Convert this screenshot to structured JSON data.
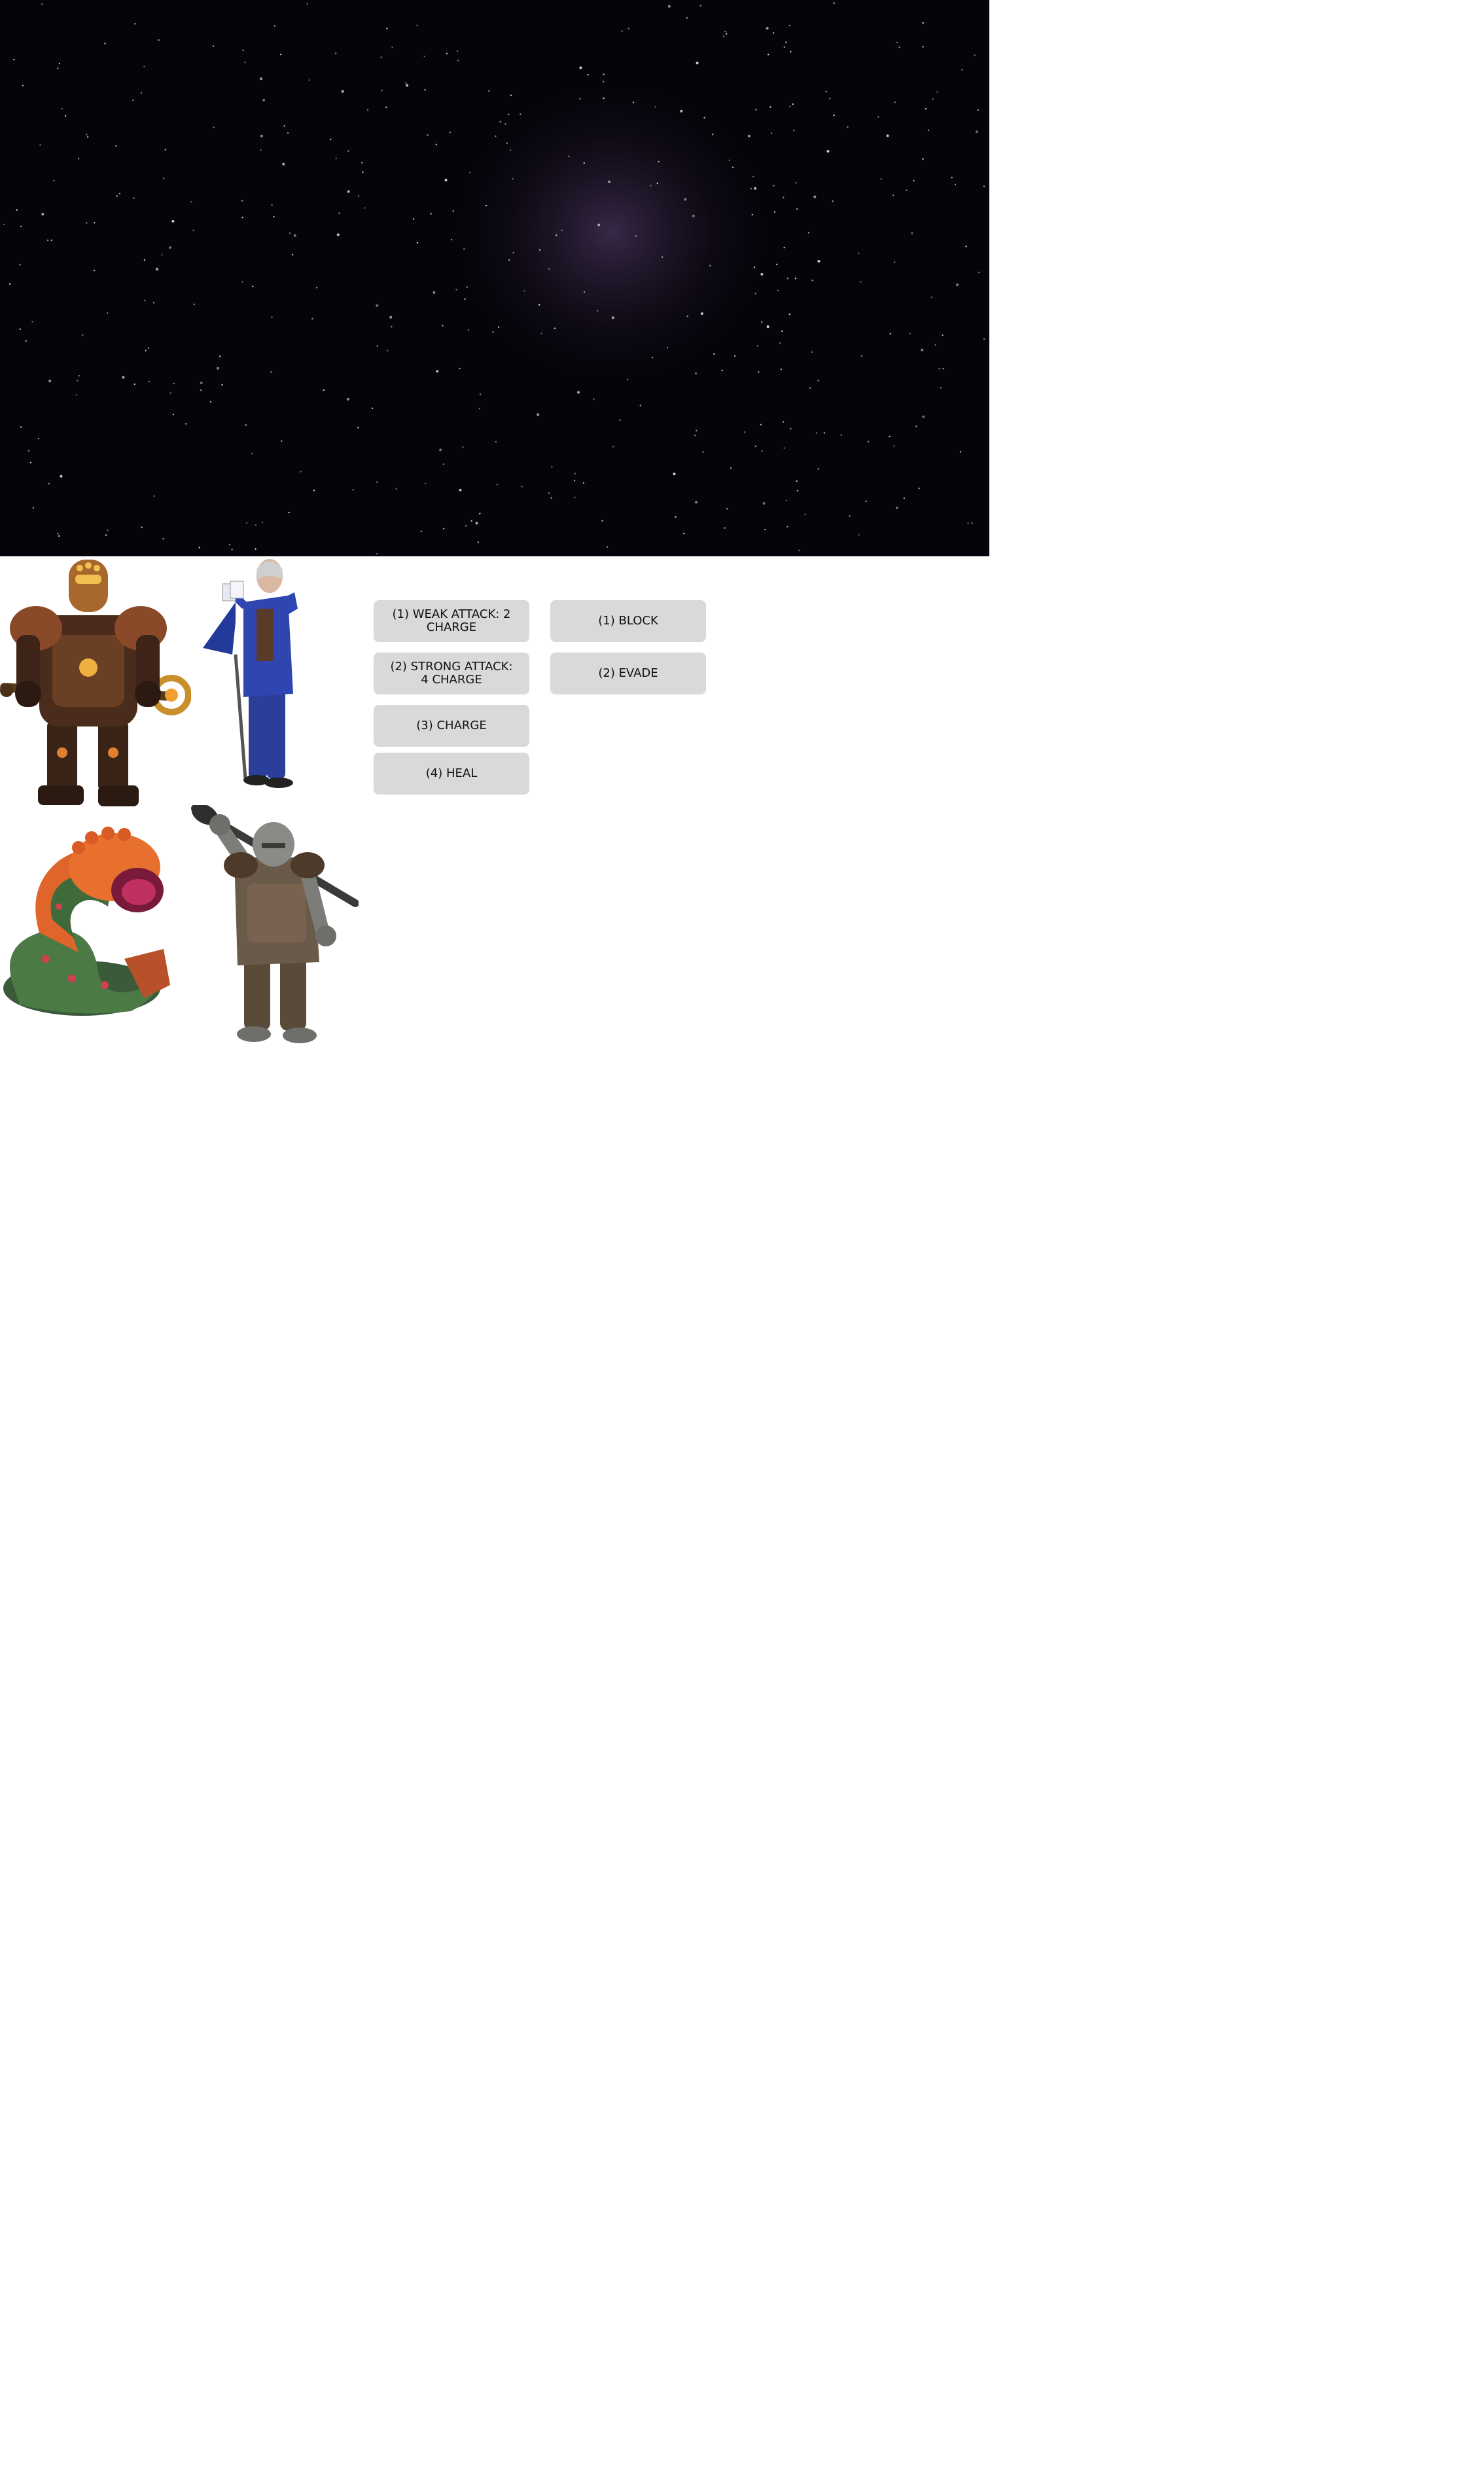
{
  "scene": {
    "background": "starfield",
    "colors": {
      "space": "#05040a",
      "nebula": "#3a2a4a",
      "star": "#cfd8d0"
    }
  },
  "characters": [
    {
      "id": "golem",
      "icon": "armored-golem-with-staff"
    },
    {
      "id": "wizard",
      "icon": "old-wizard-in-blue-suit-with-cane"
    },
    {
      "id": "worm",
      "icon": "orange-green-sandworm"
    },
    {
      "id": "orc",
      "icon": "stone-orc-with-club"
    }
  ],
  "attack_actions": [
    {
      "label": "(1) WEAK ATTACK: 2 CHARGE"
    },
    {
      "label": "(2) STRONG ATTACK: 4 CHARGE"
    },
    {
      "label": "(3) CHARGE"
    },
    {
      "label": "(4) HEAL"
    }
  ],
  "defense_actions": [
    {
      "label": "(1) BLOCK"
    },
    {
      "label": "(2) EVADE"
    }
  ],
  "button_color": "#d9d9d9"
}
